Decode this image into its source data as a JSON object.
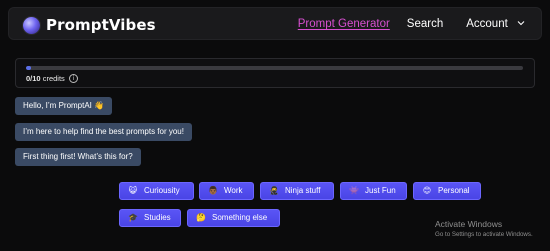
{
  "header": {
    "brand": "PromptVibes",
    "nav": [
      {
        "label": "Prompt Generator",
        "active": true
      },
      {
        "label": "Search",
        "active": false
      },
      {
        "label": "Account",
        "active": false
      }
    ]
  },
  "credits": {
    "count": "0/10",
    "suffix": "credits",
    "info_icon": "i",
    "progress_fraction": 0.01
  },
  "chat": {
    "messages": [
      {
        "text": "Hello, I’m PromptAI 👋"
      },
      {
        "text": "I’m here to help find the best prompts for you!"
      },
      {
        "text": "First thing first! What’s this for?"
      }
    ]
  },
  "choices": [
    {
      "emoji": "😺",
      "label": "Curiousity"
    },
    {
      "emoji": "👨🏾",
      "label": "Work"
    },
    {
      "emoji": "🥷",
      "label": "Ninja stuff"
    },
    {
      "emoji": "👾",
      "label": "Just Fun"
    },
    {
      "emoji": "😊",
      "label": "Personal"
    },
    {
      "emoji": "🎓",
      "label": "Studies"
    },
    {
      "emoji": "🤔",
      "label": "Something else"
    }
  ],
  "watermark": {
    "title": "Activate Windows",
    "subtitle": "Go to Settings to activate Windows."
  },
  "colors": {
    "accent_link": "#d74fd0",
    "button": "#5049ee",
    "bubble": "#3a4a64",
    "progress": "#5b6fe8"
  }
}
